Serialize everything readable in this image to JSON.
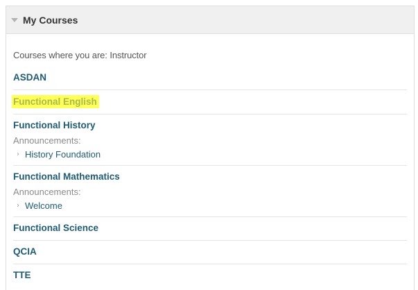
{
  "module": {
    "title": "My Courses",
    "collapse_icon": "caret-down-icon",
    "role_line": "Courses where you are: Instructor"
  },
  "courses": [
    {
      "name": "ASDAN"
    },
    {
      "name": "Functional English",
      "highlighted": true,
      "highlight_color": "#ffff5a"
    },
    {
      "name": "Functional History",
      "announcements_label": "Announcements:",
      "announcements": [
        "History Foundation"
      ]
    },
    {
      "name": "Functional Mathematics",
      "announcements_label": "Announcements:",
      "announcements": [
        "Welcome"
      ]
    },
    {
      "name": "Functional Science"
    },
    {
      "name": "QCIA"
    },
    {
      "name": "TTE"
    }
  ],
  "colors": {
    "link": "#1f5b73",
    "header_bg": "#f0f0f0",
    "highlight": "#ffff5a"
  }
}
